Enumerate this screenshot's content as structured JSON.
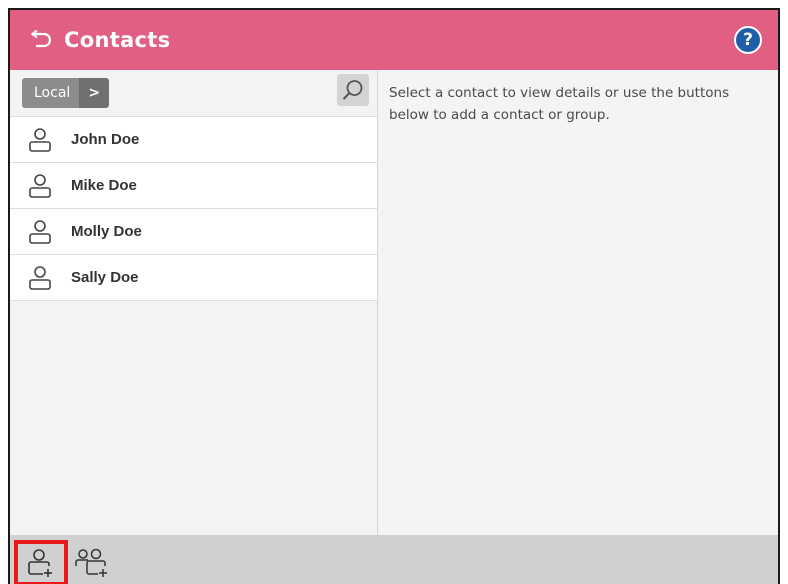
{
  "header": {
    "title": "Contacts",
    "back_icon": "back-arrow-icon",
    "help_label": "?",
    "background": "#e05f82"
  },
  "toolbar": {
    "source_label": "Local",
    "source_arrow": ">",
    "search_icon": "search-icon"
  },
  "contacts": [
    {
      "name": "John Doe"
    },
    {
      "name": "Mike Doe"
    },
    {
      "name": "Molly Doe"
    },
    {
      "name": "Sally Doe"
    }
  ],
  "details": {
    "hint": "Select a contact to view details or use the buttons below to add a contact or group."
  },
  "footer": {
    "add_contact_icon": "add-contact-icon",
    "add_group_icon": "add-group-icon",
    "highlight_color": "#e8191d"
  }
}
